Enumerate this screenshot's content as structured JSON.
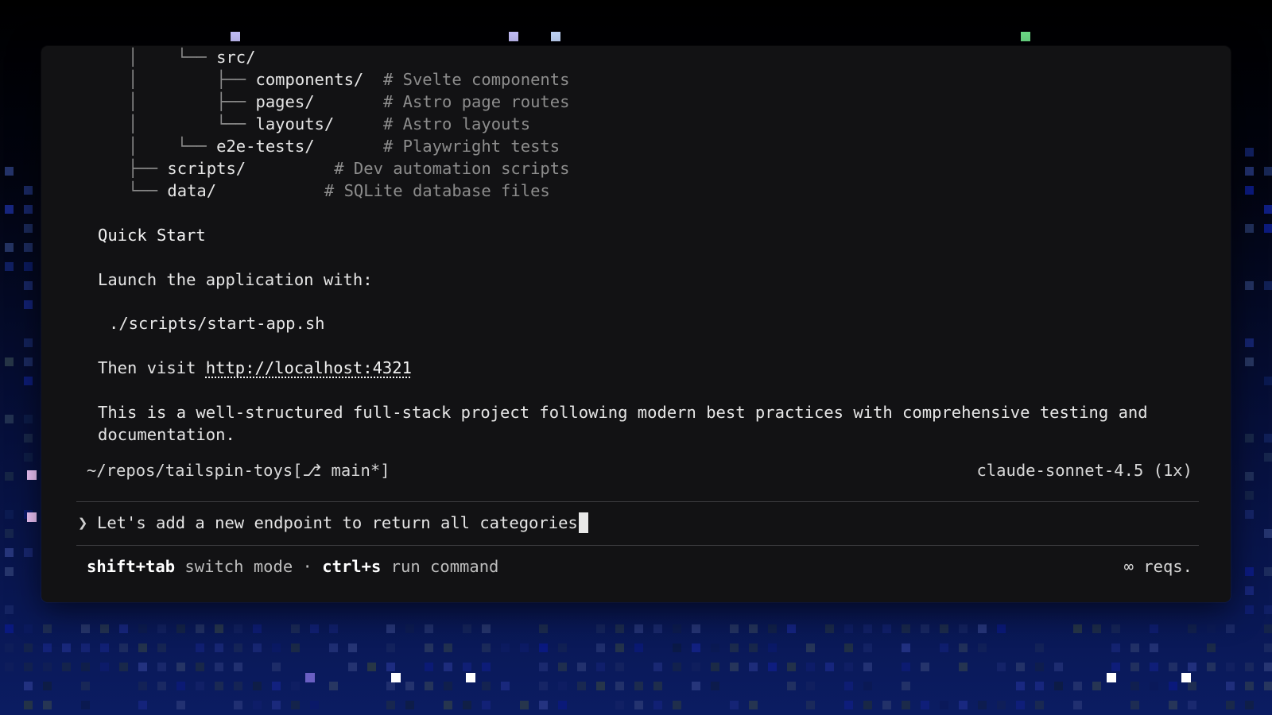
{
  "tree": [
    {
      "indent": "   │    └── ",
      "name": "src/",
      "comment": ""
    },
    {
      "indent": "   │        ├── ",
      "name": "components/",
      "pad": "  ",
      "comment": "# Svelte components"
    },
    {
      "indent": "   │        ├── ",
      "name": "pages/",
      "pad": "       ",
      "comment": "# Astro page routes"
    },
    {
      "indent": "   │        └── ",
      "name": "layouts/",
      "pad": "     ",
      "comment": "# Astro layouts"
    },
    {
      "indent": "   │    └── ",
      "name": "e2e-tests/",
      "pad": "       ",
      "comment": "# Playwright tests"
    },
    {
      "indent": "   ├── ",
      "name": "scripts/",
      "pad": "         ",
      "comment": "# Dev automation scripts"
    },
    {
      "indent": "   └── ",
      "name": "data/",
      "pad": "           ",
      "comment": "# SQLite database files"
    }
  ],
  "content": {
    "quick_start_heading": "Quick Start",
    "launch_text": "Launch the application with:",
    "command": "./scripts/start-app.sh",
    "visit_prefix": "Then visit ",
    "visit_link": "http://localhost:4321",
    "summary_line1": "This is a well-structured full-stack project following modern best practices with comprehensive testing and",
    "summary_line2": "documentation."
  },
  "status": {
    "path": "~/repos/tailspin-toys[⎇ main*]",
    "model": "claude-sonnet-4.5 (1x)"
  },
  "prompt": {
    "glyph": "❯",
    "value": "Let's add a new endpoint to return all categories"
  },
  "hints": {
    "key1": "shift+tab",
    "label1": " switch mode · ",
    "key2": "ctrl+s",
    "label2": " run command",
    "reqs": "∞ reqs."
  },
  "colors": {
    "terminal_bg": "#121214",
    "background_top": "#000000",
    "background_bottom": "#0a1a5c"
  }
}
